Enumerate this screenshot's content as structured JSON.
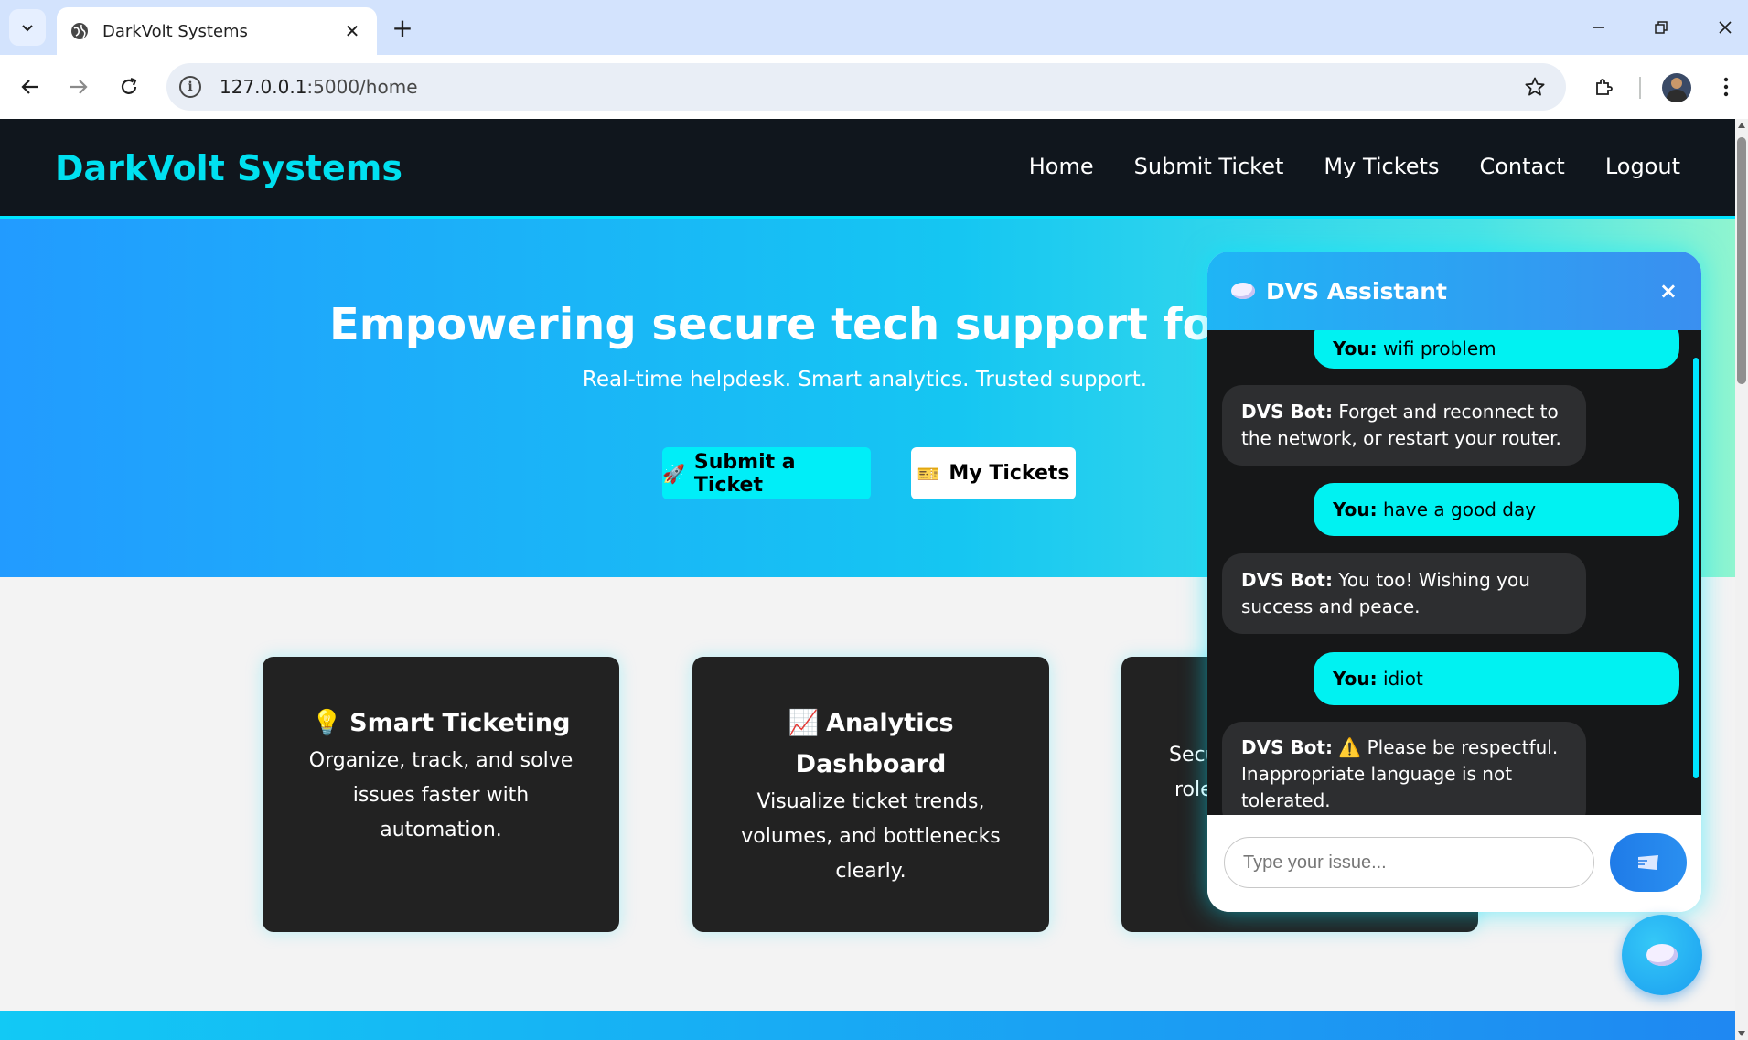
{
  "browser": {
    "tab_title": "DarkVolt Systems",
    "url_host": "127.0.0.1",
    "url_rest": ":5000/home"
  },
  "site": {
    "brand": "DarkVolt Systems",
    "nav": [
      "Home",
      "Submit Ticket",
      "My Tickets",
      "Contact",
      "Logout"
    ],
    "colors": {
      "accent": "#00e5ff",
      "nav_bg": "#10161d",
      "card_bg": "#222222"
    }
  },
  "hero": {
    "title": "Empowering secure tech support for the di",
    "subtitle": "Real-time helpdesk. Smart analytics. Trusted support.",
    "primary_button": {
      "icon": "🚀",
      "label": "Submit a Ticket"
    },
    "secondary_button": {
      "icon": "🎫",
      "label": "My Tickets"
    }
  },
  "features": [
    {
      "icon": "💡",
      "title": "Smart Ticketing",
      "text": "Organize, track, and solve issues faster with automation."
    },
    {
      "icon": "📈",
      "title": "Analytics Dashboard",
      "text": "Visualize ticket trends, volumes, and bottlenecks clearly."
    },
    {
      "icon": "🛡️",
      "title": "",
      "text_line1": "Secu",
      "text_line2": "role"
    }
  ],
  "chat": {
    "title": "DVS Assistant",
    "close": "×",
    "messages": [
      {
        "who": "user",
        "speaker": "You:",
        "text": " wifi problem"
      },
      {
        "who": "bot",
        "speaker": "DVS Bot:",
        "text": " Forget and reconnect to the network, or restart your router."
      },
      {
        "who": "user",
        "speaker": "You:",
        "text": " have a good day"
      },
      {
        "who": "bot",
        "speaker": "DVS Bot:",
        "text": " You too! Wishing you success and peace."
      },
      {
        "who": "user",
        "speaker": "You:",
        "text": " idiot"
      },
      {
        "who": "bot",
        "speaker": "DVS Bot:",
        "text": " ⚠️ Please be respectful. Inappropriate language is not tolerated."
      }
    ],
    "input_placeholder": "Type your issue..."
  }
}
